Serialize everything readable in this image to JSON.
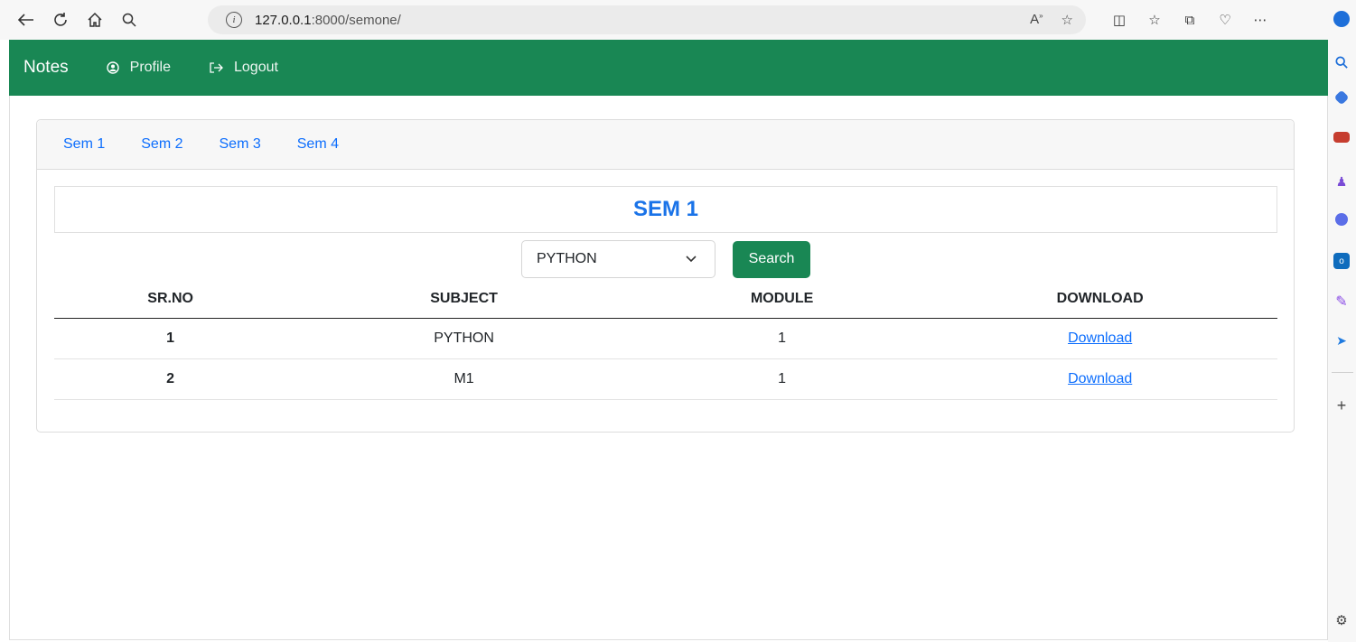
{
  "browser": {
    "url_host": "127.0.0.1",
    "url_path": ":8000/semone/"
  },
  "navbar": {
    "brand": "Notes",
    "profile_label": "Profile",
    "logout_label": "Logout"
  },
  "tabs": [
    {
      "label": "Sem 1"
    },
    {
      "label": "Sem 2"
    },
    {
      "label": "Sem 3"
    },
    {
      "label": "Sem 4"
    }
  ],
  "main": {
    "title": "SEM 1",
    "select_value": "PYTHON",
    "search_label": "Search"
  },
  "table": {
    "headers": [
      "SR.NO",
      "SUBJECT",
      "MODULE",
      "DOWNLOAD"
    ],
    "rows": [
      {
        "sr": "1",
        "subject": "PYTHON",
        "module": "1",
        "download": "Download"
      },
      {
        "sr": "2",
        "subject": "M1",
        "module": "1",
        "download": "Download"
      }
    ]
  },
  "colors": {
    "navbar": "#198754",
    "link": "#0d6efd",
    "title": "#1a73e8"
  }
}
